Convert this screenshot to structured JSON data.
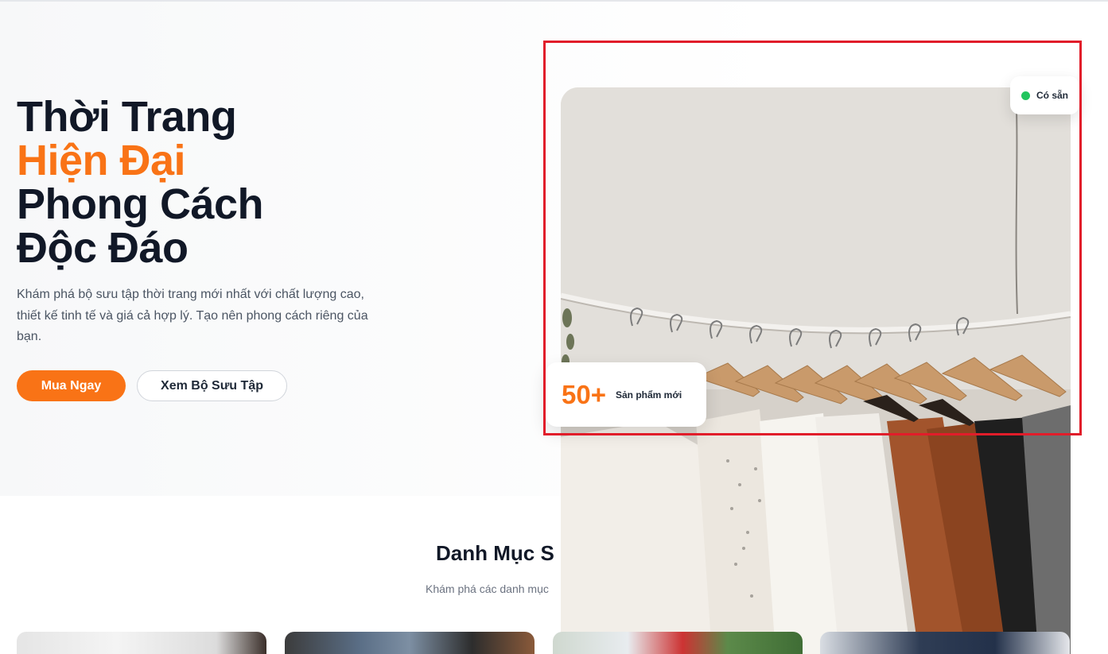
{
  "hero": {
    "title_line1": "Thời Trang",
    "title_line2": "Hiện Đại",
    "title_line3": "Phong Cách",
    "title_line4": "Độc Đáo",
    "description": "Khám phá bộ sưu tập thời trang mới nhất với chất lượng cao, thiết kế tinh tế và giá cả hợp lý. Tạo nên phong cách riêng của bạn.",
    "primary_button": "Mua Ngay",
    "secondary_button": "Xem Bộ Sưu Tập"
  },
  "availability_badge": {
    "label": "Có sẵn",
    "status_color": "#22c55e"
  },
  "stat_card": {
    "value": "50+",
    "label": "Sản phẩm mới"
  },
  "categories_section": {
    "title": "Danh Mục S",
    "subtitle": "Khám phá các danh mục"
  },
  "colors": {
    "accent": "#f97316",
    "highlight_border": "#e11d2a"
  }
}
